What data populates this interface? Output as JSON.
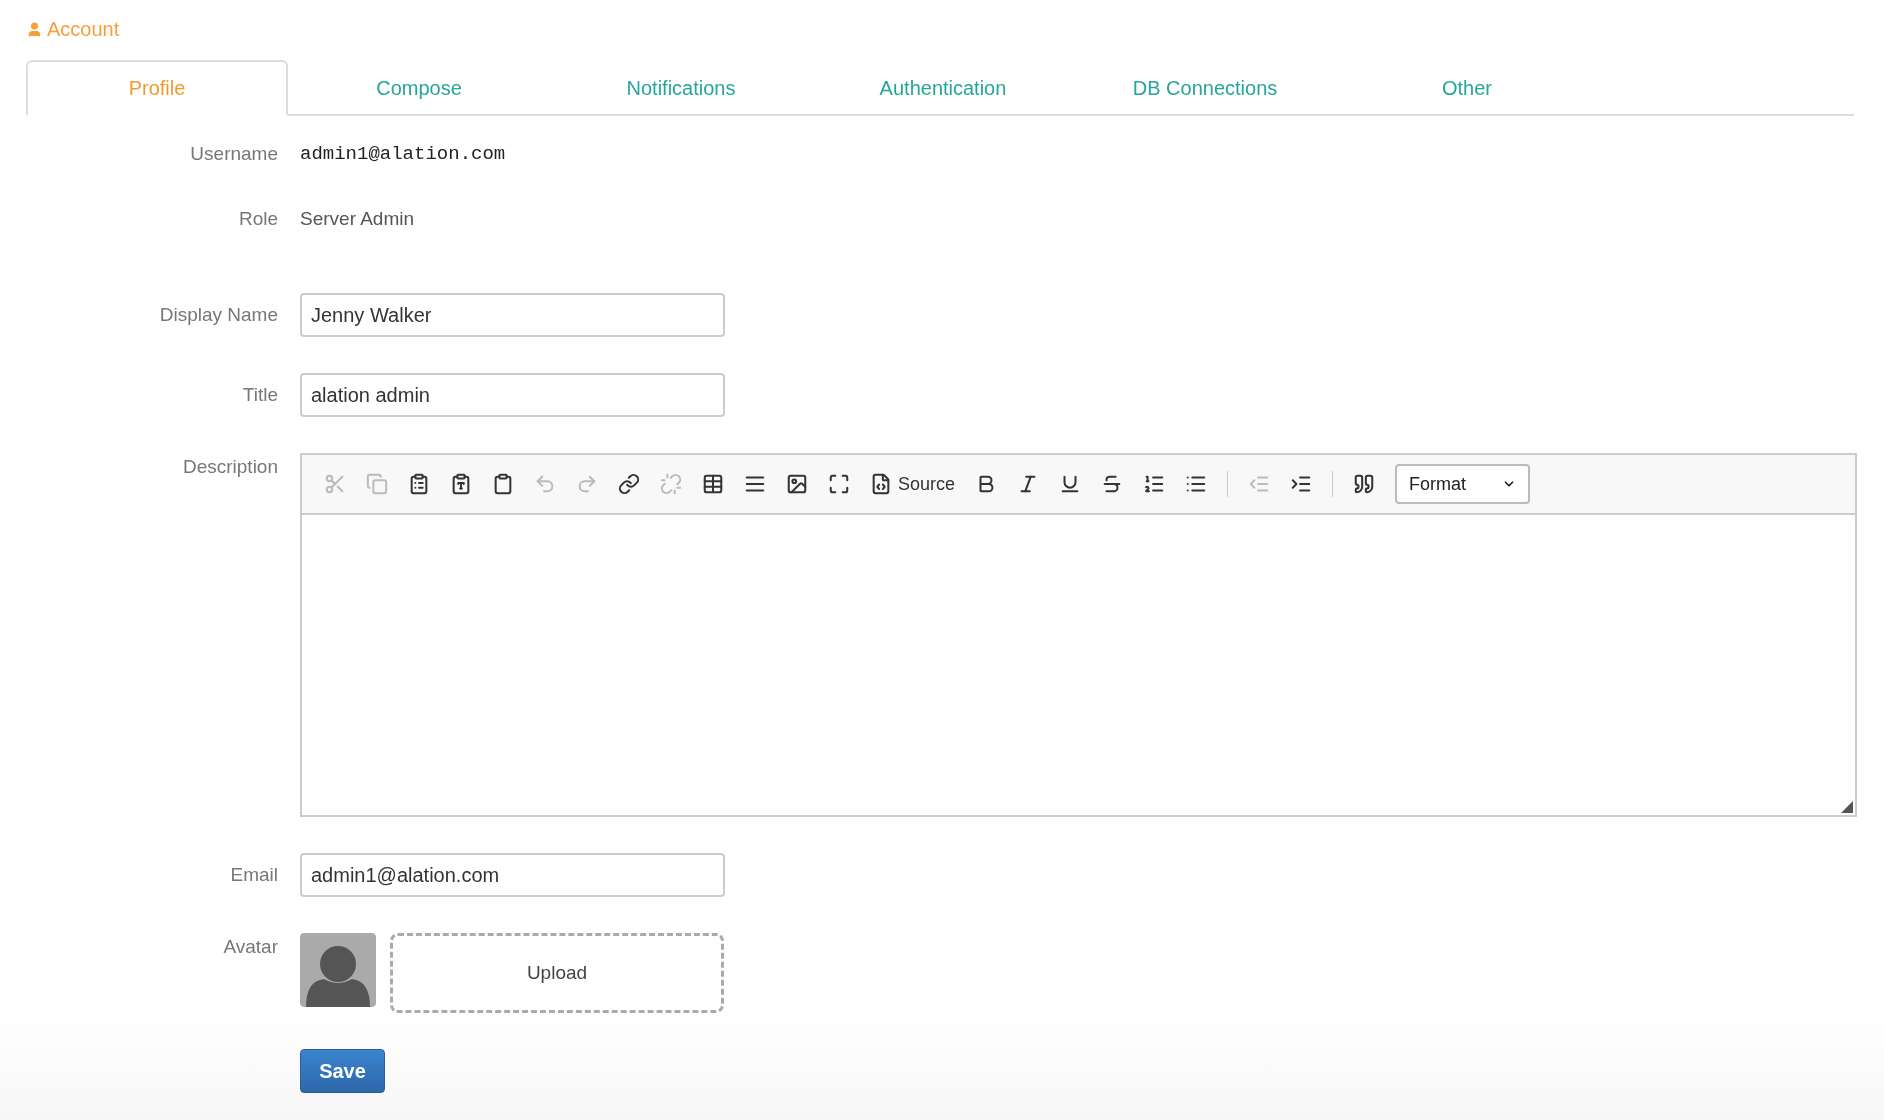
{
  "header": {
    "title": "Account"
  },
  "tabs": [
    {
      "label": "Profile",
      "selected": true
    },
    {
      "label": "Compose",
      "selected": false
    },
    {
      "label": "Notifications",
      "selected": false
    },
    {
      "label": "Authentication",
      "selected": false
    },
    {
      "label": "DB Connections",
      "selected": false
    },
    {
      "label": "Other",
      "selected": false
    }
  ],
  "profile": {
    "username": {
      "label": "Username",
      "value": "admin1@alation.com"
    },
    "role": {
      "label": "Role",
      "value": "Server Admin"
    },
    "display_name": {
      "label": "Display Name",
      "value": "Jenny Walker"
    },
    "title": {
      "label": "Title",
      "value": "alation admin"
    },
    "description": {
      "label": "Description",
      "toolbar": [
        {
          "kind": "button",
          "disabled": true
        },
        {
          "kind": "button",
          "disabled": true
        },
        {
          "kind": "button",
          "disabled": false
        },
        {
          "kind": "button",
          "disabled": false
        },
        {
          "kind": "button",
          "disabled": false
        },
        {
          "kind": "button",
          "disabled": true
        },
        {
          "kind": "button",
          "disabled": true
        },
        {
          "kind": "button",
          "disabled": false
        },
        {
          "kind": "button",
          "disabled": true
        },
        {
          "kind": "button",
          "disabled": false
        },
        {
          "kind": "button",
          "disabled": false
        },
        {
          "kind": "button",
          "disabled": false
        },
        {
          "kind": "button",
          "disabled": false
        },
        {
          "kind": "button",
          "disabled": false,
          "label": "Source"
        },
        {
          "kind": "button",
          "disabled": false
        },
        {
          "kind": "button",
          "disabled": false
        },
        {
          "kind": "button",
          "disabled": false
        },
        {
          "kind": "button",
          "disabled": false
        },
        {
          "kind": "button",
          "disabled": false
        },
        {
          "kind": "button",
          "disabled": false
        },
        {
          "kind": "separator"
        },
        {
          "kind": "button",
          "disabled": true
        },
        {
          "kind": "button",
          "disabled": false
        },
        {
          "kind": "separator"
        },
        {
          "kind": "button",
          "disabled": false
        },
        {
          "kind": "dropdown",
          "label": "Format"
        }
      ]
    },
    "email": {
      "label": "Email",
      "value": "admin1@alation.com"
    },
    "avatar": {
      "label": "Avatar",
      "upload": "Upload"
    },
    "save": "Save"
  }
}
